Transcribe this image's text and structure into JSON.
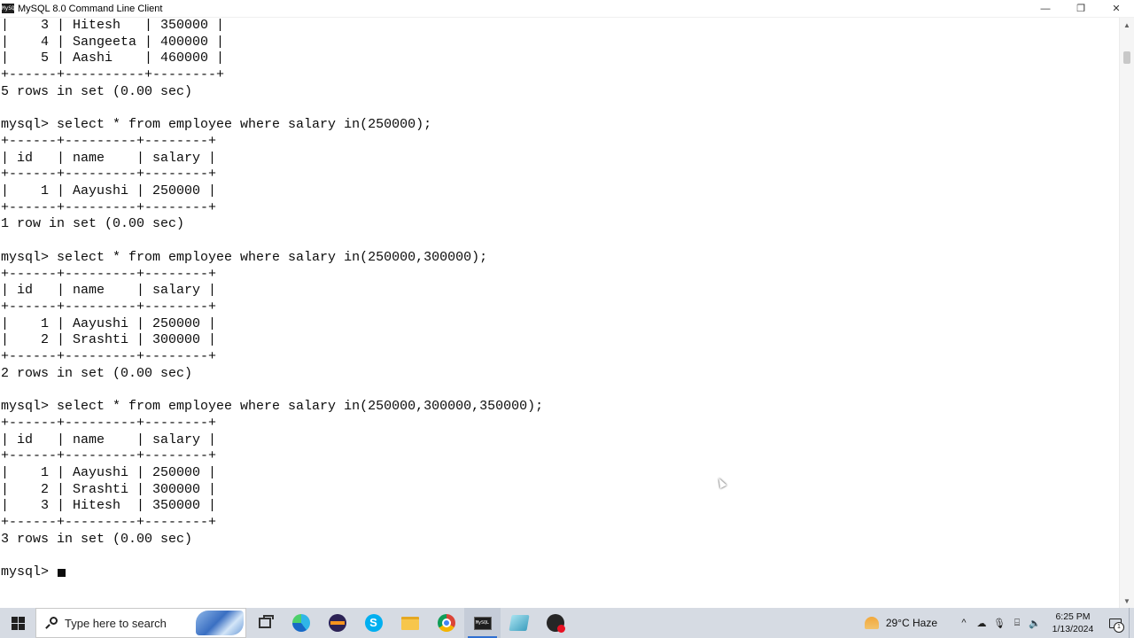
{
  "window": {
    "title": "MySQL 8.0 Command Line Client",
    "app_icon_text": "MySQL",
    "minimize_glyph": "—",
    "maximize_glyph": "❐",
    "close_glyph": "✕"
  },
  "console": {
    "lines": [
      "|    3 | Hitesh   | 350000 |",
      "|    4 | Sangeeta | 400000 |",
      "|    5 | Aashi    | 460000 |",
      "+------+----------+--------+",
      "5 rows in set (0.00 sec)",
      "",
      "mysql> select * from employee where salary in(250000);",
      "+------+---------+--------+",
      "| id   | name    | salary |",
      "+------+---------+--------+",
      "|    1 | Aayushi | 250000 |",
      "+------+---------+--------+",
      "1 row in set (0.00 sec)",
      "",
      "mysql> select * from employee where salary in(250000,300000);",
      "+------+---------+--------+",
      "| id   | name    | salary |",
      "+------+---------+--------+",
      "|    1 | Aayushi | 250000 |",
      "|    2 | Srashti | 300000 |",
      "+------+---------+--------+",
      "2 rows in set (0.00 sec)",
      "",
      "mysql> select * from employee where salary in(250000,300000,350000);",
      "+------+---------+--------+",
      "| id   | name    | salary |",
      "+------+---------+--------+",
      "|    1 | Aayushi | 250000 |",
      "|    2 | Srashti | 300000 |",
      "|    3 | Hitesh  | 350000 |",
      "+------+---------+--------+",
      "3 rows in set (0.00 sec)",
      ""
    ],
    "prompt": "mysql> "
  },
  "taskbar": {
    "search_placeholder": "Type here to search",
    "apps": [
      {
        "name": "task-view-icon",
        "label": "Task View"
      },
      {
        "name": "edge-icon",
        "label": "Microsoft Edge"
      },
      {
        "name": "eclipse-icon",
        "label": "Eclipse"
      },
      {
        "name": "skype-icon",
        "label": "Skype"
      },
      {
        "name": "file-explorer-icon",
        "label": "File Explorer"
      },
      {
        "name": "chrome-icon",
        "label": "Google Chrome"
      },
      {
        "name": "mysql-cmd-icon",
        "label": "MySQL 8.0 Command Line Client"
      },
      {
        "name": "workbench-icon",
        "label": "MySQL Workbench"
      },
      {
        "name": "screen-recorder-icon",
        "label": "Screen Recorder"
      }
    ],
    "mysql_icon_text": "MySQL",
    "skype_glyph": "S",
    "weather": "29°C  Haze",
    "tray_glyphs": {
      "chevron": "^",
      "onedrive": "☁",
      "mic": "🎙",
      "network": "⌸",
      "volume": "🔈"
    },
    "time": "6:25 PM",
    "date": "1/13/2024",
    "notification_count": "1"
  },
  "colors": {
    "console_bg": "#ffffff",
    "console_text": "#0c0c0c",
    "taskbar_bg": "#d6dbe3",
    "accent": "#2f6fd1"
  }
}
